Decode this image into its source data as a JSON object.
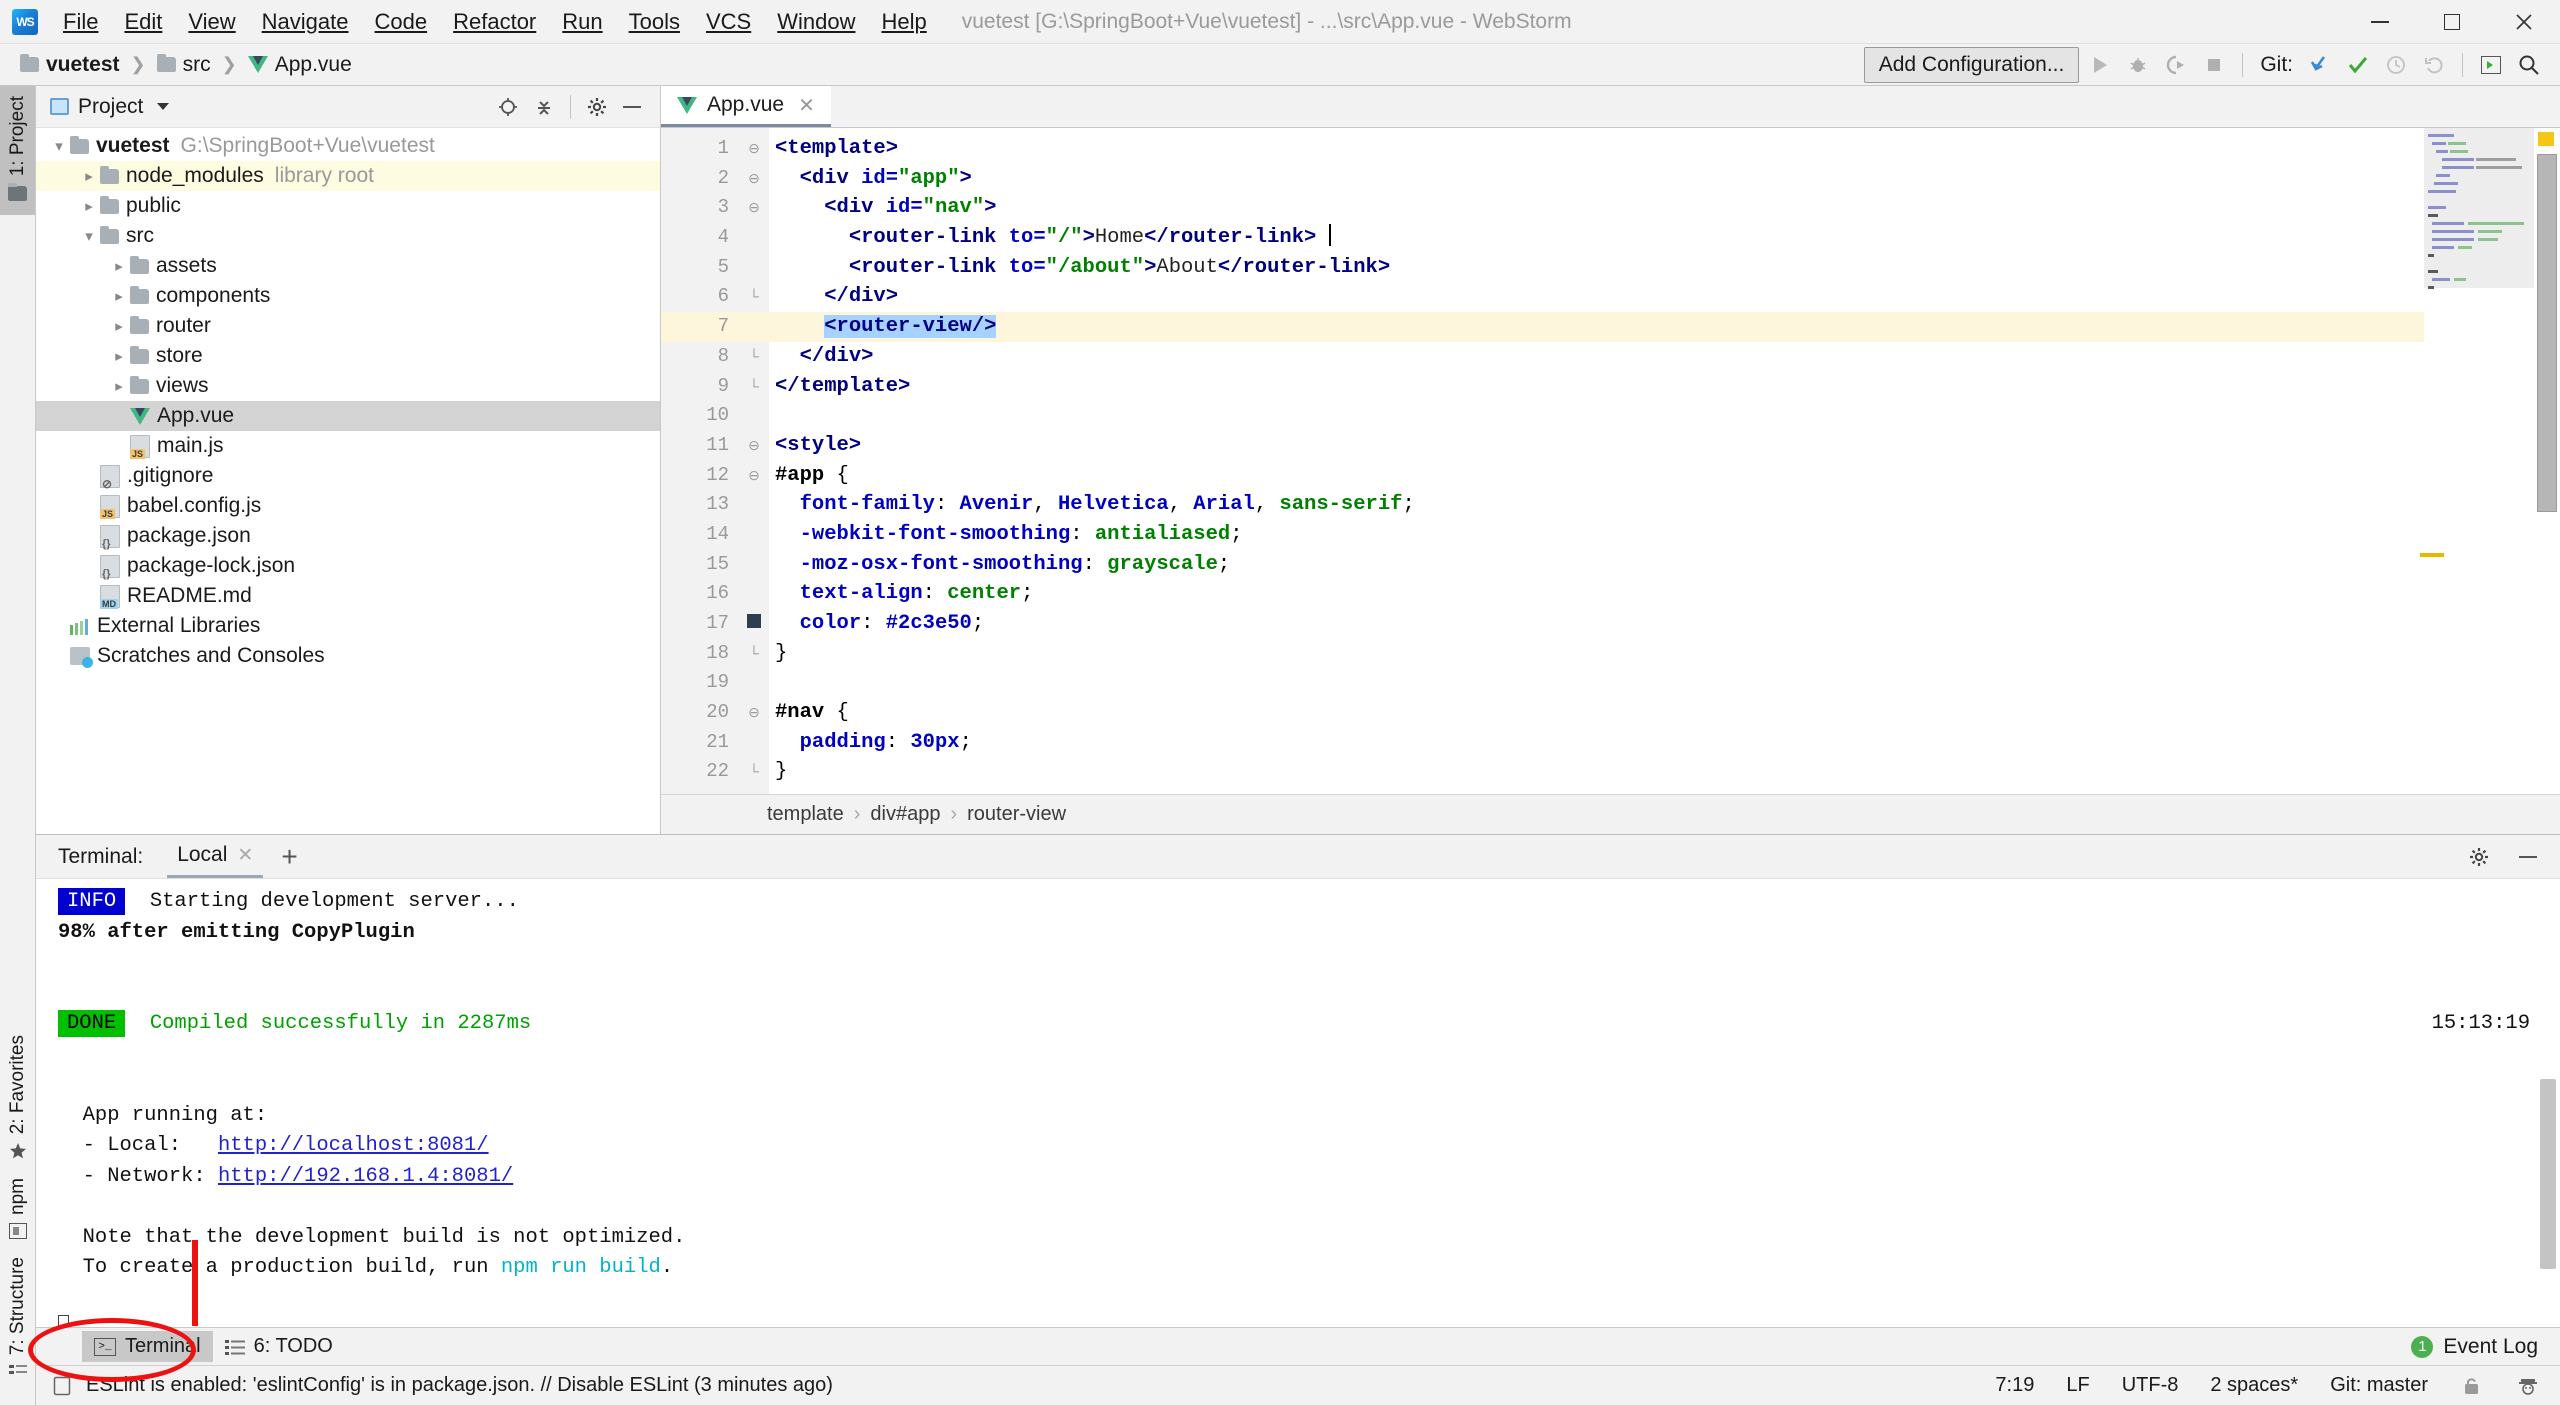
{
  "window": {
    "title": "vuetest [G:\\SpringBoot+Vue\\vuetest] - ...\\src\\App.vue - WebStorm",
    "logo_text": "WS",
    "minimize": "—",
    "maximize": "☐",
    "close": "✕"
  },
  "menu": [
    {
      "label": "File"
    },
    {
      "label": "Edit"
    },
    {
      "label": "View"
    },
    {
      "label": "Navigate"
    },
    {
      "label": "Code"
    },
    {
      "label": "Refactor"
    },
    {
      "label": "Run"
    },
    {
      "label": "Tools"
    },
    {
      "label": "VCS"
    },
    {
      "label": "Window"
    },
    {
      "label": "Help"
    }
  ],
  "navbar": {
    "breadcrumbs": [
      {
        "label": "vuetest",
        "icon": "folder-icon"
      },
      {
        "label": "src",
        "icon": "folder-icon"
      },
      {
        "label": "App.vue",
        "icon": "vue-file-icon"
      }
    ],
    "add_configuration": "Add Configuration...",
    "git_label": "Git:",
    "icons": [
      "run-icon",
      "debug-icon",
      "run-coverage-icon",
      "stop-icon",
      "update-project-icon",
      "commit-icon",
      "history-icon",
      "rollback-icon",
      "show-tool-window-icon",
      "search-everywhere-icon"
    ]
  },
  "left_rail": {
    "project_button": "1: Project",
    "bottom_items": [
      {
        "label": "2: Favorites",
        "icon": "star-icon"
      },
      {
        "label": "npm",
        "icon": "npm-icon"
      },
      {
        "label": "7: Structure",
        "icon": "structure-icon"
      }
    ]
  },
  "project_panel": {
    "title": "Project",
    "actions": [
      "locate-icon",
      "collapse-all-icon",
      "settings-gear-icon",
      "hide-icon"
    ],
    "tree": [
      {
        "depth": 0,
        "arrow": "down",
        "icon": "folder-icon",
        "label": "vuetest",
        "sub": "G:\\SpringBoot+Vue\\vuetest",
        "bold": true,
        "state": "normal"
      },
      {
        "depth": 1,
        "arrow": "right",
        "icon": "folder-icon",
        "label": "node_modules",
        "sub": "library root",
        "bold": false,
        "state": "highlight"
      },
      {
        "depth": 1,
        "arrow": "right",
        "icon": "folder-icon",
        "label": "public",
        "sub": "",
        "bold": false,
        "state": "normal"
      },
      {
        "depth": 1,
        "arrow": "down",
        "icon": "folder-icon",
        "label": "src",
        "sub": "",
        "bold": false,
        "state": "normal"
      },
      {
        "depth": 2,
        "arrow": "right",
        "icon": "folder-icon",
        "label": "assets",
        "sub": "",
        "bold": false,
        "state": "normal"
      },
      {
        "depth": 2,
        "arrow": "right",
        "icon": "folder-icon",
        "label": "components",
        "sub": "",
        "bold": false,
        "state": "normal"
      },
      {
        "depth": 2,
        "arrow": "right",
        "icon": "folder-icon",
        "label": "router",
        "sub": "",
        "bold": false,
        "state": "normal"
      },
      {
        "depth": 2,
        "arrow": "right",
        "icon": "folder-icon",
        "label": "store",
        "sub": "",
        "bold": false,
        "state": "normal"
      },
      {
        "depth": 2,
        "arrow": "right",
        "icon": "folder-icon",
        "label": "views",
        "sub": "",
        "bold": false,
        "state": "normal"
      },
      {
        "depth": 2,
        "arrow": "none",
        "icon": "vue-file-icon",
        "label": "App.vue",
        "sub": "",
        "bold": false,
        "state": "selected"
      },
      {
        "depth": 2,
        "arrow": "none",
        "icon": "js-file-icon",
        "label": "main.js",
        "sub": "",
        "bold": false,
        "state": "normal"
      },
      {
        "depth": 1,
        "arrow": "none",
        "icon": "gitignore-file-icon",
        "label": ".gitignore",
        "sub": "",
        "bold": false,
        "state": "normal"
      },
      {
        "depth": 1,
        "arrow": "none",
        "icon": "js-file-icon",
        "label": "babel.config.js",
        "sub": "",
        "bold": false,
        "state": "normal"
      },
      {
        "depth": 1,
        "arrow": "none",
        "icon": "json-file-icon",
        "label": "package.json",
        "sub": "",
        "bold": false,
        "state": "normal"
      },
      {
        "depth": 1,
        "arrow": "none",
        "icon": "json-file-icon",
        "label": "package-lock.json",
        "sub": "",
        "bold": false,
        "state": "normal"
      },
      {
        "depth": 1,
        "arrow": "none",
        "icon": "md-file-icon",
        "label": "README.md",
        "sub": "",
        "bold": false,
        "state": "normal"
      },
      {
        "depth": 0,
        "arrow": "none",
        "icon": "external-libraries-icon",
        "label": "External Libraries",
        "sub": "",
        "bold": false,
        "state": "normal"
      },
      {
        "depth": 0,
        "arrow": "none",
        "icon": "scratches-icon",
        "label": "Scratches and Consoles",
        "sub": "",
        "bold": false,
        "state": "normal"
      }
    ]
  },
  "editor": {
    "tab": {
      "label": "App.vue",
      "icon": "vue-file-icon",
      "close": "✕"
    },
    "breadcrumb": [
      "template",
      "div#app",
      "router-view"
    ],
    "breadcrumb_sep": "›",
    "lines": [
      {
        "n": "1",
        "fold": "minus",
        "current": false
      },
      {
        "n": "2",
        "fold": "minus",
        "current": false
      },
      {
        "n": "3",
        "fold": "minus",
        "current": false
      },
      {
        "n": "4",
        "fold": "",
        "current": false
      },
      {
        "n": "5",
        "fold": "",
        "current": false
      },
      {
        "n": "6",
        "fold": "end",
        "current": false
      },
      {
        "n": "7",
        "fold": "",
        "current": true
      },
      {
        "n": "8",
        "fold": "end",
        "current": false
      },
      {
        "n": "9",
        "fold": "end",
        "current": false
      },
      {
        "n": "10",
        "fold": "",
        "current": false
      },
      {
        "n": "11",
        "fold": "minus",
        "current": false
      },
      {
        "n": "12",
        "fold": "minus",
        "current": false
      },
      {
        "n": "13",
        "fold": "",
        "current": false
      },
      {
        "n": "14",
        "fold": "",
        "current": false
      },
      {
        "n": "15",
        "fold": "",
        "current": false
      },
      {
        "n": "16",
        "fold": "",
        "current": false
      },
      {
        "n": "17",
        "fold": "",
        "current": false
      },
      {
        "n": "18",
        "fold": "end",
        "current": false
      },
      {
        "n": "19",
        "fold": "",
        "current": false
      },
      {
        "n": "20",
        "fold": "minus",
        "current": false
      },
      {
        "n": "21",
        "fold": "",
        "current": false
      },
      {
        "n": "22",
        "fold": "end",
        "current": false
      }
    ],
    "source_text": [
      "<template>",
      "  <div id=\"app\">",
      "    <div id=\"nav\">",
      "      <router-link to=\"/\">Home</router-link> |",
      "      <router-link to=\"/about\">About</router-link>",
      "    </div>",
      "    <router-view/>",
      "  </div>",
      "</template>",
      "",
      "<style>",
      "#app {",
      "  font-family: Avenir, Helvetica, Arial, sans-serif;",
      "  -webkit-font-smoothing: antialiased;",
      "  -moz-osx-font-smoothing: grayscale;",
      "  text-align: center;",
      "  color: #2c3e50;",
      "}",
      "",
      "#nav {",
      "  padding: 30px;",
      "}"
    ],
    "color_swatch": "#2c3e50"
  },
  "terminal": {
    "label": "Terminal:",
    "tab": "Local",
    "tab_close": "✕",
    "add": "+",
    "actions": [
      "settings-gear-icon",
      "hide-icon"
    ],
    "timestamp": "15:13:19",
    "lines": [
      {
        "type": "badge-info",
        "badge": "INFO",
        "text": "Starting development server..."
      },
      {
        "type": "plain-bold",
        "text": "98% after emitting CopyPlugin"
      },
      {
        "type": "blank",
        "text": ""
      },
      {
        "type": "blank",
        "text": ""
      },
      {
        "type": "badge-done",
        "badge": "DONE",
        "text": "Compiled successfully in 2287ms"
      },
      {
        "type": "blank",
        "text": ""
      },
      {
        "type": "blank",
        "text": ""
      },
      {
        "type": "plain",
        "text": "  App running at:"
      },
      {
        "type": "link",
        "prefix": "  - Local:   ",
        "link": "http://localhost:8081/"
      },
      {
        "type": "link",
        "prefix": "  - Network: ",
        "link": "http://192.168.1.4:8081/"
      },
      {
        "type": "blank",
        "text": ""
      },
      {
        "type": "plain",
        "text": "  Note that the development build is not optimized."
      },
      {
        "type": "cmd",
        "prefix": "  To create a production build, run ",
        "cmd": "npm run build",
        "suffix": "."
      },
      {
        "type": "blank",
        "text": ""
      },
      {
        "type": "prompt",
        "text": ""
      }
    ]
  },
  "bottom_toolbar": {
    "items": [
      {
        "label": "Terminal",
        "icon": "terminal-icon",
        "active": true
      },
      {
        "label": "6: TODO",
        "icon": "todo-icon",
        "active": false
      }
    ],
    "event_log": "Event Log",
    "event_count": "1"
  },
  "statusbar": {
    "message": "ESLint is enabled: 'eslintConfig' is in package.json. // Disable ESLint (3 minutes ago)",
    "caret_position": "7:19",
    "line_separator": "LF",
    "encoding": "UTF-8",
    "indent": "2 spaces*",
    "branch": "Git: master",
    "icons": [
      "lock-icon",
      "inspector-icon"
    ]
  },
  "colors": {
    "accent_blue": "#2222cc",
    "vue_green": "#41b883",
    "vue_dark": "#35495e",
    "done_green": "#00c000",
    "info_blue": "#0000cf",
    "annotation_red": "#ee1111"
  }
}
